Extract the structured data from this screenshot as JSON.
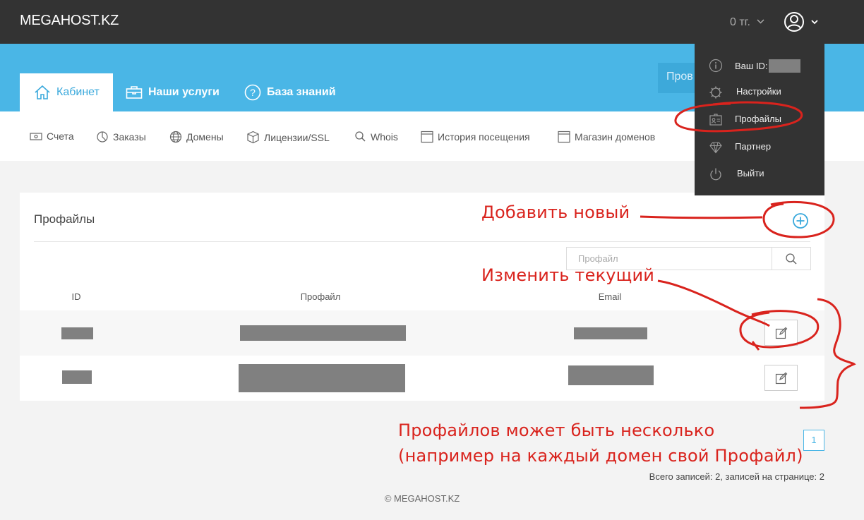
{
  "header": {
    "brand": "MEGAHOST.KZ",
    "balance": "0 тг.",
    "user_menu_icon": "user-circle-icon"
  },
  "tabs": [
    {
      "label": "Кабинет",
      "icon": "home-icon",
      "active": true
    },
    {
      "label": "Наши услуги",
      "icon": "briefcase-icon",
      "active": false
    },
    {
      "label": "База знаний",
      "icon": "question-icon",
      "active": false
    }
  ],
  "band_button_label": "Пров",
  "subnav": [
    {
      "label": "Счета",
      "icon": "money-icon"
    },
    {
      "label": "Заказы",
      "icon": "pie-chart-icon"
    },
    {
      "label": "Домены",
      "icon": "globe-icon"
    },
    {
      "label": "Лицензии/SSL",
      "icon": "cube-icon"
    },
    {
      "label": "Whois",
      "icon": "search-icon"
    },
    {
      "label": "История посещения",
      "icon": "window-icon"
    },
    {
      "label": "Магазин доменов",
      "icon": "window-icon"
    }
  ],
  "panel": {
    "title": "Профайлы",
    "search_placeholder": "Профайл",
    "columns": [
      "ID",
      "Профайл",
      "Email"
    ],
    "rows": [
      {
        "id": "",
        "profile": "",
        "email": ""
      },
      {
        "id": "",
        "profile": "",
        "email": ""
      }
    ]
  },
  "pagination": {
    "page": "1",
    "records": "Всего записей: 2, записей на странице: 2"
  },
  "footer": "© MEGAHOST.KZ",
  "dropdown": [
    {
      "label": "Ваш ID:",
      "icon": "info-icon"
    },
    {
      "label": "Настройки",
      "icon": "gear-icon"
    },
    {
      "label": "Профайлы",
      "icon": "id-card-icon"
    },
    {
      "label": "Партнер",
      "icon": "diamond-icon"
    },
    {
      "label": "Выйти",
      "icon": "power-icon"
    }
  ],
  "annotations": {
    "add_new": "Добавить новый",
    "edit_current": "Изменить текущий",
    "multiple_line1": "Профайлов может быть несколько",
    "multiple_line2": "(например на каждый домен свой Профайл)",
    "color": "#d9231d"
  },
  "colors": {
    "topbar": "#333333",
    "accent": "#4ab6e6",
    "redaction": "#808080"
  }
}
